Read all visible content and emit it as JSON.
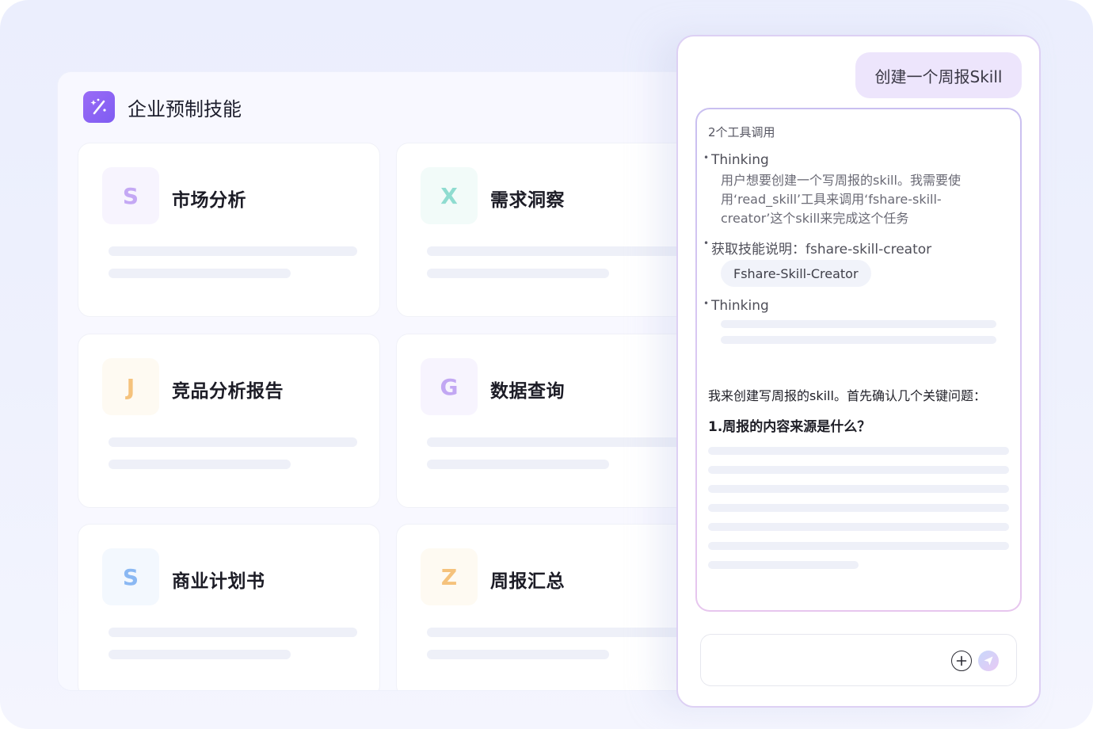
{
  "skills_panel": {
    "title": "企业预制技能",
    "cards": [
      {
        "letter": "S",
        "title": "市场分析",
        "letter_color": "#c4a8f4",
        "badge_bg": "#f7f4fe"
      },
      {
        "letter": "X",
        "title": "需求洞察",
        "letter_color": "#8fdcd0",
        "badge_bg": "#f2fbf9"
      },
      {
        "letter": "J",
        "title": "竞品分析报告",
        "letter_color": "#f5c27c",
        "badge_bg": "#fefaf2"
      },
      {
        "letter": "G",
        "title": "数据查询",
        "letter_color": "#c2a7f3",
        "badge_bg": "#f7f4fe"
      },
      {
        "letter": "S",
        "title": "商业计划书",
        "letter_color": "#8ab8f3",
        "badge_bg": "#f3f8fe"
      },
      {
        "letter": "Z",
        "title": "周报汇总",
        "letter_color": "#f5c27c",
        "badge_bg": "#fefaf2"
      }
    ]
  },
  "chat": {
    "user_message": "创建一个周报Skill",
    "reply": {
      "tool_count": "2个工具调用",
      "thinking_1_label": "Thinking",
      "thinking_1_text": "用户想要创建一个写周报的skill。我需要使用‘read_skill’工具来调用‘fshare-skill-creator’这个skill来完成这个任务",
      "fetch_label": "获取技能说明：fshare-skill-creator",
      "fetch_chip": "Fshare-Skill-Creator",
      "thinking_2_label": "Thinking",
      "answer_intro": "我来创建写周报的skill。首先确认几个关键问题：",
      "answer_question": "1.周报的内容来源是什么？"
    },
    "input": {
      "placeholder": ""
    }
  },
  "colors": {
    "accent": "#8a63f4",
    "bubble_bg": "#ede5fc"
  },
  "icons": {
    "logo": "magic-wand-icon",
    "plus": "plus-circle-icon",
    "send": "send-icon"
  }
}
